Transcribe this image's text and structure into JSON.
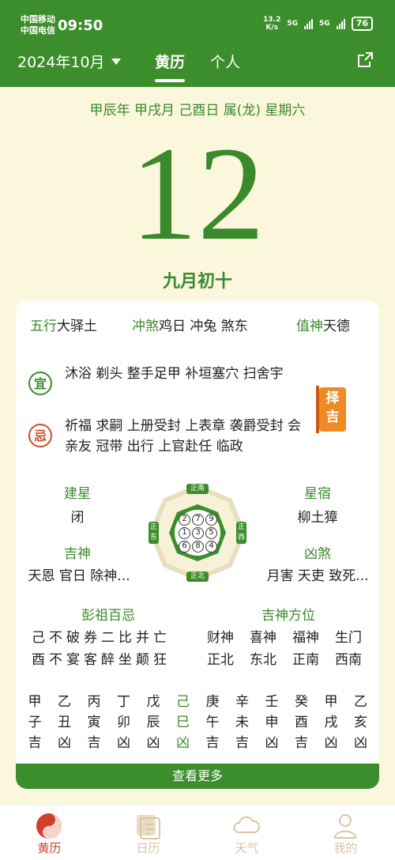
{
  "status": {
    "carrier1": "中国移动",
    "carrier2": "中国电信",
    "time": "09:50",
    "speed_top": "13.2",
    "speed_unit": "K/s",
    "net1": "5G",
    "net2": "5G",
    "battery": "76"
  },
  "nav": {
    "month": "2024年10月",
    "tab_huangli": "黄历",
    "tab_personal": "个人"
  },
  "date": {
    "ganzhi_line": "甲辰年 甲戌月 己酉日 属(龙) 星期六",
    "day": "12",
    "lunar": "九月初十"
  },
  "info": {
    "wuxing_label": "五行",
    "wuxing_value": "大驿土",
    "chongsha_label": "冲煞",
    "chongsha_value": "鸡日 冲兔 煞东",
    "zhishen_label": "值神",
    "zhishen_value": "天德"
  },
  "yiji": {
    "yi_icon": "宜",
    "yi_text": "沐浴 剃头 整手足甲 补垣塞穴 扫舍宇",
    "ji_icon": "忌",
    "ji_text": "祈福 求嗣 上册受封 上表章 袭爵受封 会亲友 冠带 出行 上官赴任 临政",
    "zeji_label": "择吉"
  },
  "stars": {
    "jianxing_label": "建星",
    "jianxing_value": "闭",
    "xingsu_label": "星宿",
    "xingsu_value": "柳土獐",
    "jishen_label": "吉神",
    "jishen_value": "天恩 官日 除神...",
    "xiongsha_label": "凶煞",
    "xiongsha_value": "月害 天吏 致死..."
  },
  "compass": {
    "north": "正北",
    "south": "正南",
    "east": "正东",
    "west": "正西",
    "numbers": [
      "2",
      "7",
      "9",
      "1",
      "3",
      "5",
      "6",
      "8",
      "4"
    ]
  },
  "pengzu": {
    "label": "彭祖百忌",
    "line1": "己不破券二比并亡",
    "line2": "酉不宴客醉坐颠狂"
  },
  "fangwei": {
    "label": "吉神方位",
    "headers": [
      "财神",
      "喜神",
      "福神",
      "生门"
    ],
    "values": [
      "正北",
      "东北",
      "正南",
      "西南"
    ]
  },
  "shichen": [
    {
      "gan": "甲",
      "zhi": "子",
      "luck": "吉"
    },
    {
      "gan": "乙",
      "zhi": "丑",
      "luck": "凶"
    },
    {
      "gan": "丙",
      "zhi": "寅",
      "luck": "吉"
    },
    {
      "gan": "丁",
      "zhi": "卯",
      "luck": "凶"
    },
    {
      "gan": "戊",
      "zhi": "辰",
      "luck": "凶"
    },
    {
      "gan": "己",
      "zhi": "巳",
      "luck": "凶"
    },
    {
      "gan": "庚",
      "zhi": "午",
      "luck": "吉"
    },
    {
      "gan": "辛",
      "zhi": "未",
      "luck": "吉"
    },
    {
      "gan": "壬",
      "zhi": "申",
      "luck": "凶"
    },
    {
      "gan": "癸",
      "zhi": "酉",
      "luck": "吉"
    },
    {
      "gan": "甲",
      "zhi": "戌",
      "luck": "凶"
    },
    {
      "gan": "乙",
      "zhi": "亥",
      "luck": "凶"
    }
  ],
  "more_button": "查看更多",
  "bottom_nav": [
    {
      "label": "黄历",
      "icon": "yinyang-icon"
    },
    {
      "label": "日历",
      "icon": "calendar-icon"
    },
    {
      "label": "天气",
      "icon": "cloud-icon"
    },
    {
      "label": "我的",
      "icon": "person-icon"
    }
  ],
  "colors": {
    "brand_green": "#3b8e2b",
    "accent_red": "#d0402a",
    "background": "#fbf7dc"
  }
}
